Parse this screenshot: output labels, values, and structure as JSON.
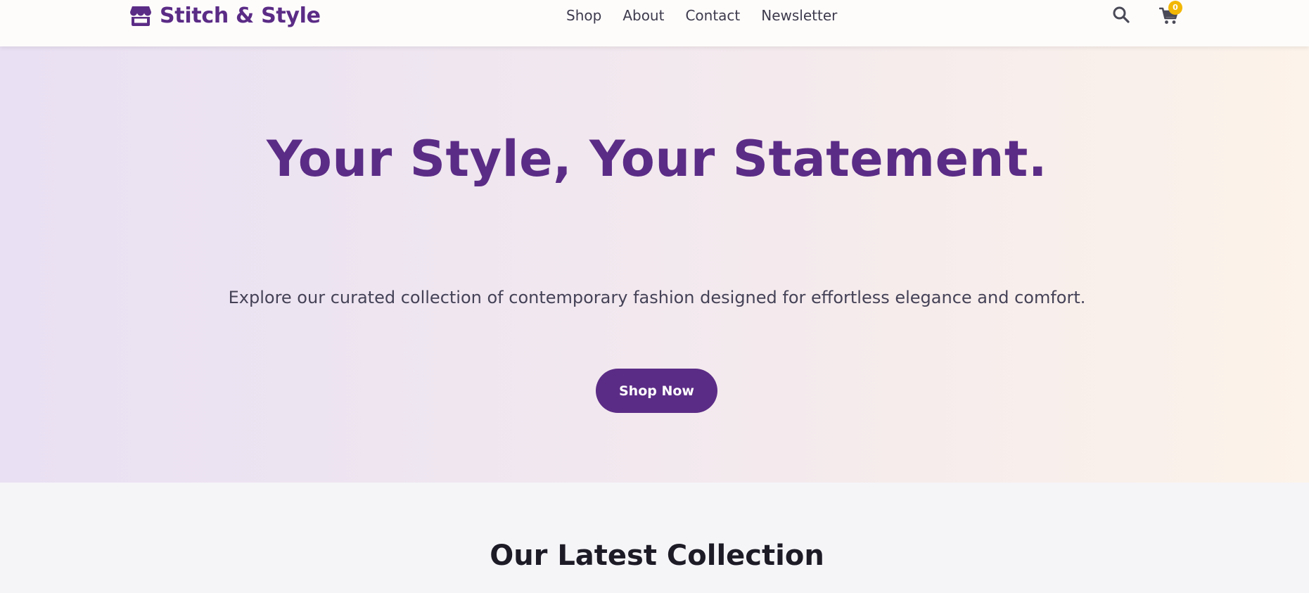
{
  "header": {
    "brand": "Stitch & Style",
    "logo_icon": "storefront-icon",
    "nav": [
      {
        "label": "Shop"
      },
      {
        "label": "About"
      },
      {
        "label": "Contact"
      },
      {
        "label": "Newsletter"
      }
    ],
    "search_icon": "search-icon",
    "cart_icon": "cart-icon",
    "cart_count": "0"
  },
  "hero": {
    "title": "Your Style, Your Statement.",
    "subtitle": "Explore our curated collection of contemporary fashion designed for effortless elegance and comfort.",
    "cta_label": "Shop Now"
  },
  "collection": {
    "title": "Our Latest Collection"
  },
  "colors": {
    "brand": "#5b2c86",
    "badge": "#f2b705",
    "hero_gradient_start": "#e9e0f3",
    "hero_gradient_end": "#fcf3ea",
    "section_bg": "#f5f5f8"
  }
}
